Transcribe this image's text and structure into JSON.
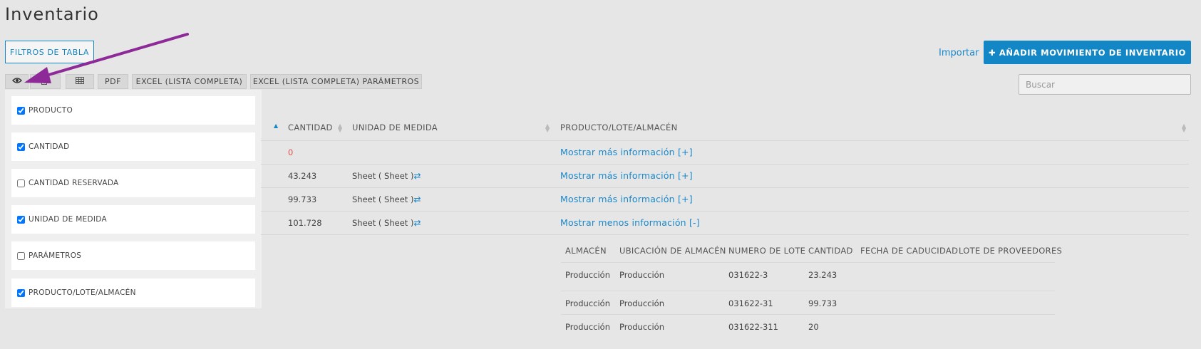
{
  "page": {
    "title": "Inventario"
  },
  "toolbar": {
    "filters_label": "FILTROS DE TABLA",
    "import_label": "Importar",
    "add_label": "✚ AÑADIR MOVIMIENTO DE INVENTARIO",
    "buttons": [
      "PDF",
      "EXCEL (LISTA COMPLETA)",
      "EXCEL (LISTA COMPLETA) PARÁMETROS"
    ],
    "icons": [
      "eye-icon",
      "copy-icon",
      "table-icon"
    ]
  },
  "search": {
    "placeholder": "Buscar",
    "value": ""
  },
  "columns_panel": {
    "items": [
      {
        "label": "PRODUCTO",
        "checked": true
      },
      {
        "label": "CANTIDAD",
        "checked": true
      },
      {
        "label": "CANTIDAD RESERVADA",
        "checked": false
      },
      {
        "label": "UNIDAD DE MEDIDA",
        "checked": true
      },
      {
        "label": "PARÁMETROS",
        "checked": false
      },
      {
        "label": "PRODUCTO/LOTE/ALMACÉN",
        "checked": true
      }
    ]
  },
  "table": {
    "headers": [
      "CANTIDAD",
      "UNIDAD DE MEDIDA",
      "PRODUCTO/LOTE/ALMACÉN"
    ],
    "rows": [
      {
        "quantity": "0",
        "unit": "",
        "info": "Mostrar más información [+]"
      },
      {
        "quantity": "43.243",
        "unit": "Sheet ( Sheet )",
        "info": "Mostrar más información [+]"
      },
      {
        "quantity": "99.733",
        "unit": "Sheet ( Sheet )",
        "info": "Mostrar más información [+]"
      },
      {
        "quantity": "101.728",
        "unit": "Sheet ( Sheet )",
        "info": "Mostrar menos información [-]"
      }
    ],
    "swap_icon": "⇄"
  },
  "subtable": {
    "headers": [
      "ALMACÉN",
      "UBICACIÓN DE ALMACÉN",
      "NUMERO DE LOTE",
      "CANTIDAD",
      "FECHA DE CADUCIDAD",
      "LOTE DE PROVEEDORES"
    ],
    "rows": [
      [
        "Producción",
        "Producción",
        "031622-3",
        "23.243",
        "",
        ""
      ],
      [
        "Producción",
        "Producción",
        "031622-31",
        "99.733",
        "",
        ""
      ],
      [
        "Producción",
        "Producción",
        "031622-311",
        "20",
        "",
        ""
      ]
    ]
  },
  "colors": {
    "accent": "#1387c5",
    "zero": "#d9534f",
    "annotation_arrow": "#8e2a98"
  }
}
